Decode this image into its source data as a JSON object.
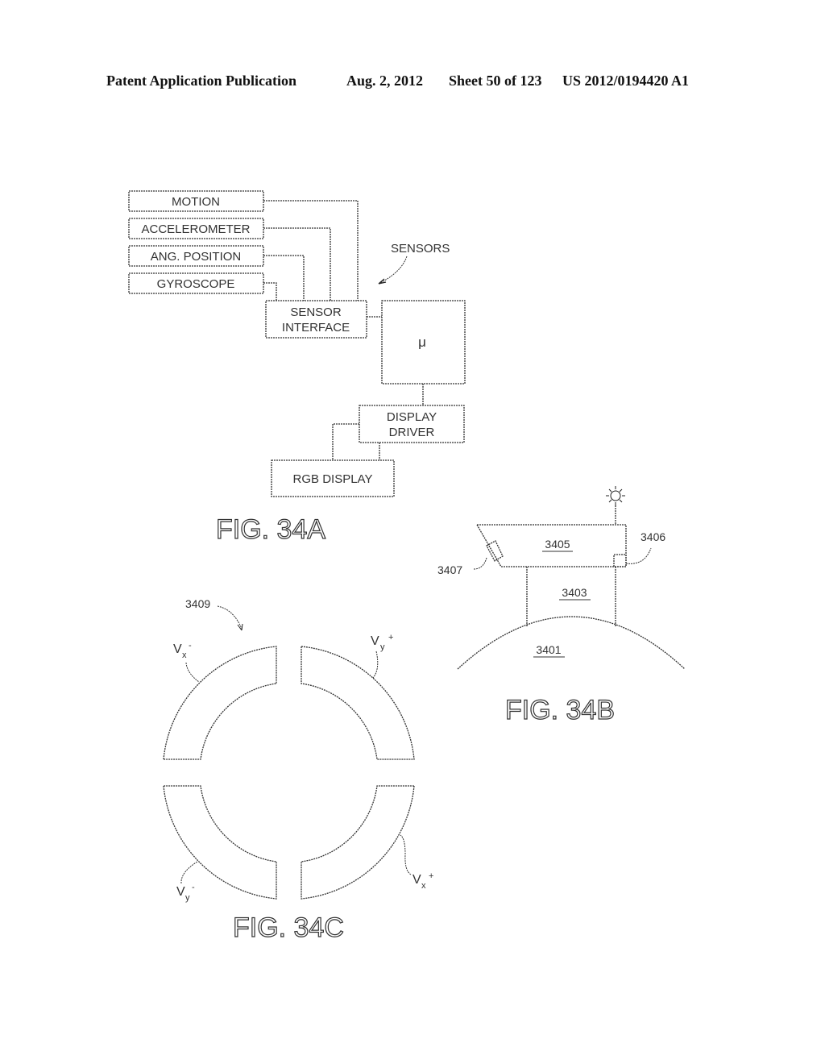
{
  "header": {
    "publication": "Patent Application Publication",
    "date": "Aug. 2, 2012",
    "sheet": "Sheet 50 of 123",
    "number": "US 2012/0194420 A1"
  },
  "fig34a": {
    "title": "FIG. 34A",
    "sensors": [
      "MOTION",
      "ACCELEROMETER",
      "ANG. POSITION",
      "GYROSCOPE"
    ],
    "sensor_interface": [
      "SENSOR",
      "INTERFACE"
    ],
    "sensors_label": "SENSORS",
    "processor": "μ",
    "display_driver": [
      "DISPLAY",
      "DRIVER"
    ],
    "rgb_display": "RGB DISPLAY"
  },
  "fig34b": {
    "title": "FIG. 34B",
    "refs": {
      "body": "3401",
      "stem": "3403",
      "housing": "3405",
      "sensor": "3406",
      "camera": "3407"
    }
  },
  "fig34c": {
    "title": "FIG. 34C",
    "ref": "3409",
    "segments": {
      "vx_minus": {
        "base": "V",
        "sub": "x",
        "sup": "-"
      },
      "vy_plus": {
        "base": "V",
        "sub": "y",
        "sup": "+"
      },
      "vy_minus": {
        "base": "V",
        "sub": "y",
        "sup": "-"
      },
      "vx_plus": {
        "base": "V",
        "sub": "x",
        "sup": "+"
      }
    }
  }
}
